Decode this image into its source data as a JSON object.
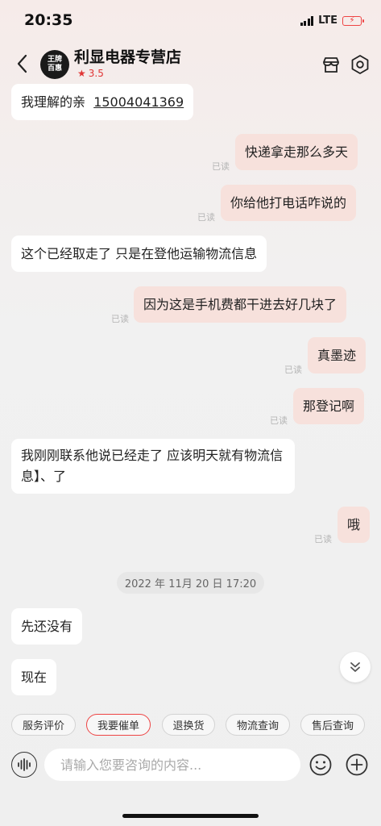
{
  "status": {
    "time": "20:35",
    "network": "LTE"
  },
  "header": {
    "avatar_text_1": "王牌",
    "avatar_text_2": "百惠",
    "shop_name": "利显电器专营店",
    "rating": "3.5"
  },
  "messages": {
    "m0": {
      "text": "我理解的亲",
      "phone": "15004041369"
    },
    "m1": {
      "text": "快递拿走那么多天",
      "read": "已读"
    },
    "m2": {
      "text": "你给他打电话咋说的",
      "read": "已读"
    },
    "m3": {
      "text": "这个已经取走了  只是在登他运输物流信息"
    },
    "m4": {
      "text": "因为这是手机费都干进去好几块了",
      "read": "已读"
    },
    "m5": {
      "text": "真墨迹",
      "read": "已读"
    },
    "m6": {
      "text": "那登记啊",
      "read": "已读"
    },
    "m7": {
      "text": "我刚刚联系他说已经走了 应该明天就有物流信息】、了"
    },
    "m8": {
      "text": "哦",
      "read": "已读"
    },
    "timestamp": "2022 年 11月 20 日 17:20",
    "m9": {
      "text": "先还没有"
    },
    "m10": {
      "text": "现在"
    }
  },
  "quick_actions": [
    "服务评价",
    "我要催单",
    "退换货",
    "物流查询",
    "售后查询"
  ],
  "input": {
    "placeholder": "请输入您要咨询的内容..."
  },
  "colors": {
    "accent": "#e44444",
    "bubble_self": "#f7e1dc",
    "bubble_other": "#ffffff"
  },
  "icons": [
    "back-arrow-icon",
    "store-icon",
    "settings-hexagon-icon",
    "chevron-double-down-icon",
    "voice-icon",
    "emoji-icon",
    "plus-icon",
    "star-icon"
  ]
}
